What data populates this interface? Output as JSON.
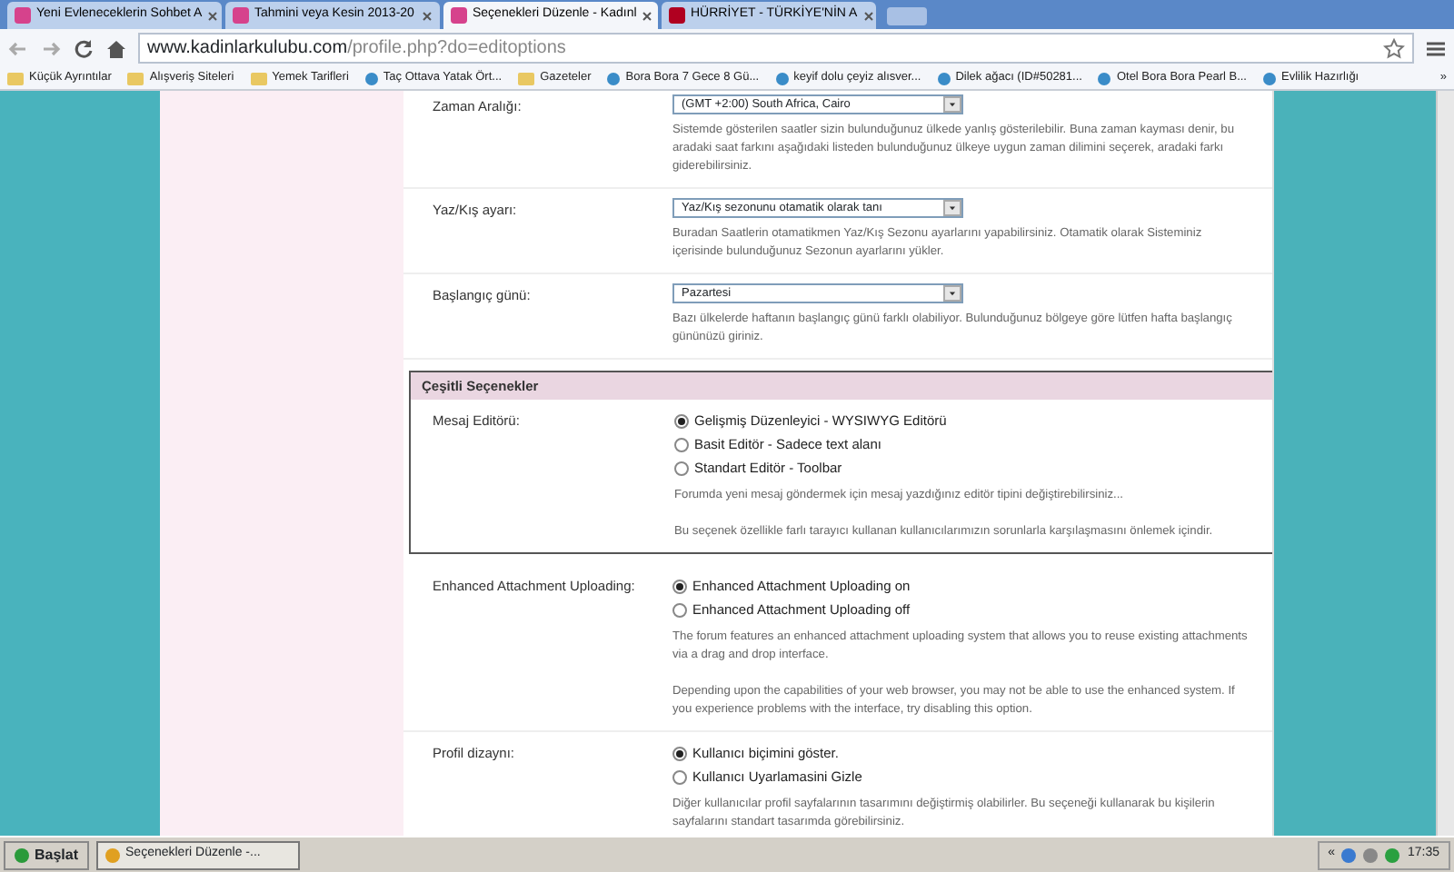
{
  "browser": {
    "tabs": [
      {
        "title": "Yeni Evleneceklerin Sohbet A",
        "selected": false
      },
      {
        "title": "Tahmini veya Kesin 2013-20",
        "selected": false
      },
      {
        "title": "Seçenekleri Düzenle - Kadınl",
        "selected": true
      },
      {
        "title": "HÜRRİYET - TÜRKİYE'NİN A",
        "selected": false
      }
    ],
    "address": {
      "host": "www.kadinlarkulubu.com",
      "path": "/profile.php?do=editoptions"
    },
    "bookmarks": [
      {
        "label": "Küçük Ayrıntılar",
        "kind": "folder"
      },
      {
        "label": "Alışveriş Siteleri",
        "kind": "folder"
      },
      {
        "label": "Yemek Tarifleri",
        "kind": "folder"
      },
      {
        "label": "Taç Ottava Yatak Ört...",
        "kind": "site"
      },
      {
        "label": "Gazeteler",
        "kind": "folder"
      },
      {
        "label": "Bora Bora 7 Gece 8 Gü...",
        "kind": "site"
      },
      {
        "label": "keyif dolu çeyiz alısver...",
        "kind": "site"
      },
      {
        "label": "Dilek ağacı (ID#50281...",
        "kind": "site"
      },
      {
        "label": "Otel Bora Bora Pearl B...",
        "kind": "site"
      },
      {
        "label": "Evlilik Hazırlığı",
        "kind": "site"
      }
    ],
    "bookmarks_more": "»"
  },
  "page": {
    "options_top": [
      {
        "label": "Zaman Aralığı:",
        "kind": "select",
        "value": "(GMT +2:00) South Africa, Cairo",
        "description": [
          "Sistemde gösterilen saatler sizin bulunduğunuz ülkede yanlış gösterilebilir. Buna zaman kayması denir, bu aradaki saat farkını aşağıdaki listeden bulunduğunuz ülkeye uygun zaman dilimini seçerek, aradaki farkı giderebilirsiniz."
        ]
      },
      {
        "label": "Yaz/Kış ayarı:",
        "kind": "select",
        "value": "Yaz/Kış sezonunu otamatik olarak tanı",
        "description": [
          "Buradan Saatlerin otamatikmen Yaz/Kış Sezonu ayarlarını yapabilirsiniz. Otamatik olarak Sisteminiz içerisinde bulunduğunuz Sezonun ayarlarını yükler."
        ]
      },
      {
        "label": "Başlangıç günü:",
        "kind": "select",
        "value": "Pazartesi",
        "description": [
          "Bazı ülkelerde haftanın başlangıç günü farklı olabiliyor. Bulunduğunuz bölgeye göre lütfen hafta başlangıç gününüzü giriniz."
        ]
      }
    ],
    "section": {
      "title": "Çeşitli Seçenekler",
      "options": [
        {
          "label": "Mesaj Editörü:",
          "kind": "radio",
          "choices": [
            {
              "label": "Gelişmiş Düzenleyici - WYSIWYG Editörü",
              "selected": true
            },
            {
              "label": "Basit Editör - Sadece text alanı",
              "selected": false
            },
            {
              "label": "Standart Editör - Toolbar",
              "selected": false
            }
          ],
          "description": [
            "Forumda yeni mesaj göndermek için mesaj yazdığınız editör tipini değiştirebilirsiniz...",
            "Bu seçenek özellikle farlı tarayıcı kullanan kullanıcılarımızın sorunlarla karşılaşmasını önlemek içindir."
          ]
        }
      ]
    },
    "options_bottom": [
      {
        "label": "Enhanced Attachment Uploading:",
        "kind": "radio",
        "choices": [
          {
            "label": "Enhanced Attachment Uploading on",
            "selected": true
          },
          {
            "label": "Enhanced Attachment Uploading off",
            "selected": false
          }
        ],
        "description": [
          "The forum features an enhanced attachment uploading system that allows you to reuse existing attachments via a drag and drop interface.",
          "Depending upon the capabilities of your web browser, you may not be able to use the enhanced system. If you experience problems with the interface, try disabling this option."
        ]
      },
      {
        "label": "Profil dizaynı:",
        "kind": "radio",
        "choices": [
          {
            "label": "Kullanıcı biçimini göster.",
            "selected": true
          },
          {
            "label": "Kullanıcı Uyarlamasini Gizle",
            "selected": false
          }
        ],
        "description": [
          "Diğer kullanıcılar profil sayfalarının tasarımını değiştirmiş olabilirler. Bu seçeneği kullanarak bu kişilerin sayfalarını standart tasarımda görebilirsiniz."
        ]
      }
    ]
  },
  "taskbar": {
    "start": "Başlat",
    "task": "Seçenekleri Düzenle -...",
    "tray_expand": "«",
    "clock": "17:35"
  }
}
